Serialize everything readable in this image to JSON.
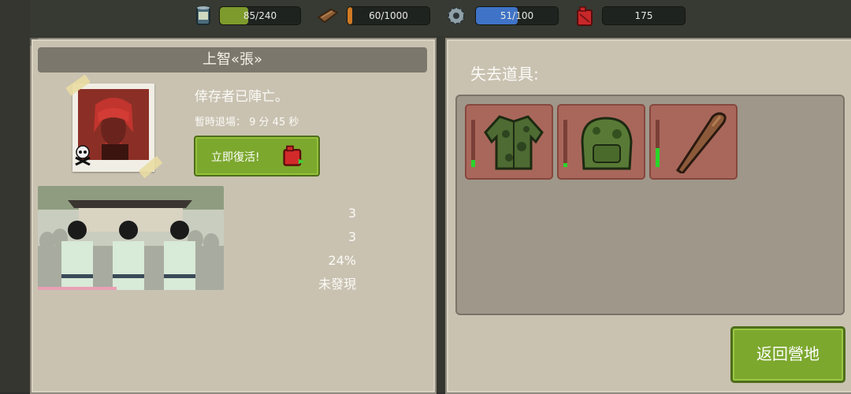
{
  "resources": [
    {
      "name": "food",
      "icon": "canned-food-icon",
      "value": "85/240",
      "level": 0.354,
      "color": "#7d9a2c"
    },
    {
      "name": "wood",
      "icon": "wood-plank-icon",
      "value": "60/1000",
      "level": 0.06,
      "color": "#d07a24"
    },
    {
      "name": "parts",
      "icon": "gear-icon",
      "value": "51/100",
      "level": 0.51,
      "color": "#3f73c7"
    },
    {
      "name": "fuel",
      "icon": "fuel-can-icon",
      "value": "175"
    }
  ],
  "survivor": {
    "name": "上智«張»",
    "status": "倖存者已陣亡。",
    "timer": "暫時退場：  9 分 45 秒",
    "revive_label": "立即復活!",
    "stats": [
      "3",
      "3",
      "24%",
      "未發現"
    ]
  },
  "lost_items": {
    "title": "失去道具:",
    "items": [
      {
        "icon": "camo-jacket-icon",
        "durability": 0.15
      },
      {
        "icon": "camo-backpack-icon",
        "durability": 0.08
      },
      {
        "icon": "baseball-bat-icon",
        "durability": 0.4
      }
    ]
  },
  "return_label": "返回營地"
}
